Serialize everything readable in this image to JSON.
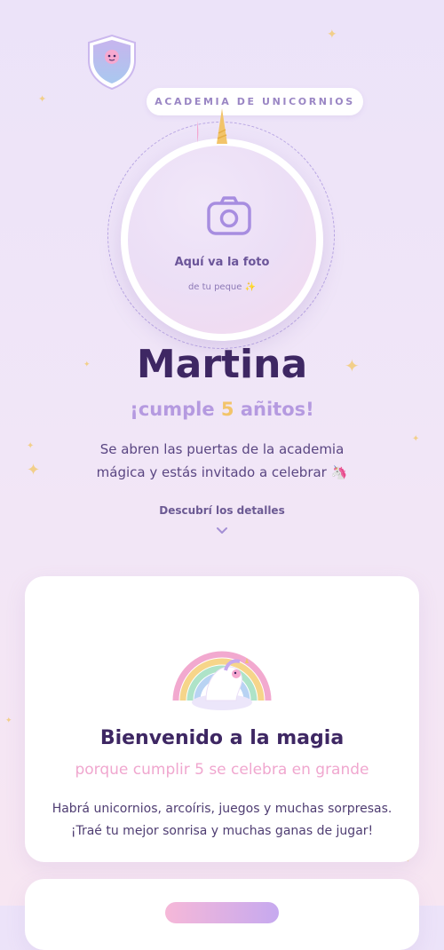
{
  "brand": {
    "academy_label": "ACADEMIA DE UNICORNIOS"
  },
  "photo": {
    "label": "Aquí va la foto",
    "sublabel": "de tu peque ✨"
  },
  "hero": {
    "name": "Martina",
    "age_prefix": "¡cumple ",
    "age_number": "5",
    "age_suffix": " añitos!",
    "intro": "Se abren las puertas de la academia mágica y estás invitado a celebrar 🦄",
    "discover_label": "Descubrí los detalles"
  },
  "welcome_card": {
    "title": "Bienvenido a la magia",
    "subtitle": "porque cumplir 5 se celebra en grande",
    "body": "Habrá unicornios, arcoíris, juegos y muchas sorpresas. ¡Traé tu mejor sonrisa y muchas ganas de jugar!"
  },
  "icons": [
    "shield-unicorn-icon",
    "camera-icon",
    "unicorn-horn-icon",
    "chevron-down-icon",
    "rainbow-unicorn-icon",
    "sparkle-icon"
  ],
  "colors": {
    "accent_purple": "#b59ae0",
    "accent_gold": "#f2c46a",
    "accent_pink": "#f0a7cf",
    "text_dark": "#3e2763"
  }
}
